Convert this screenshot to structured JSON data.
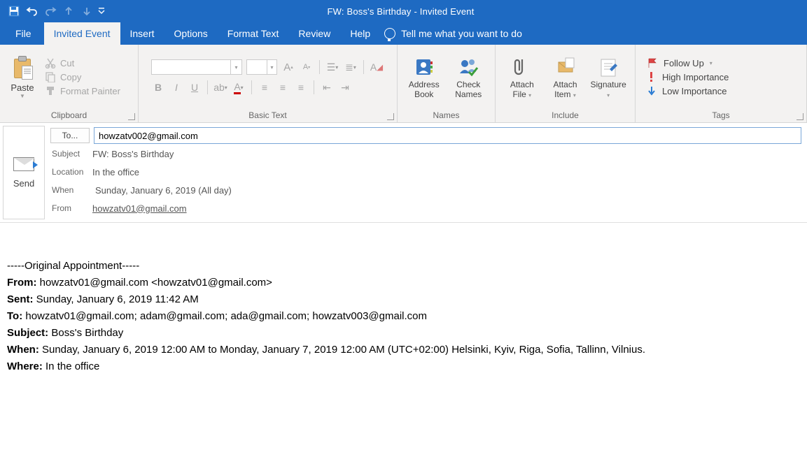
{
  "window": {
    "title": "FW: Boss's Birthday  -  Invited Event"
  },
  "tabs": {
    "file": "File",
    "invited": "Invited Event",
    "insert": "Insert",
    "options": "Options",
    "format": "Format Text",
    "review": "Review",
    "help": "Help",
    "tellme": "Tell me what you want to do"
  },
  "ribbon": {
    "clipboard": {
      "paste": "Paste",
      "cut": "Cut",
      "copy": "Copy",
      "painter": "Format Painter",
      "group": "Clipboard"
    },
    "basictext": {
      "group": "Basic Text"
    },
    "names": {
      "address1": "Address",
      "address2": "Book",
      "check1": "Check",
      "check2": "Names",
      "group": "Names"
    },
    "include": {
      "attachfile1": "Attach",
      "attachfile2": "File",
      "attachitem1": "Attach",
      "attachitem2": "Item",
      "signature": "Signature",
      "group": "Include"
    },
    "tags": {
      "followup": "Follow Up",
      "high": "High Importance",
      "low": "Low Importance",
      "group": "Tags"
    }
  },
  "compose": {
    "send": "Send",
    "to_button": "To...",
    "to_value": "howzatv002@gmail.com",
    "subject_label": "Subject",
    "subject_value": "FW: Boss's Birthday",
    "location_label": "Location",
    "location_value": "In the office",
    "when_label": "When",
    "when_value": "Sunday, January 6, 2019 (All day)",
    "from_label": "From",
    "from_value": "howzatv01@gmail.com"
  },
  "body": {
    "divider": "-----Original Appointment-----",
    "from_l": "From:",
    "from_v": " howzatv01@gmail.com <howzatv01@gmail.com>",
    "sent_l": "Sent:",
    "sent_v": " Sunday, January 6, 2019 11:42 AM",
    "to_l": "To:",
    "to_v": " howzatv01@gmail.com; adam@gmail.com; ada@gmail.com; howzatv003@gmail.com",
    "subject_l": "Subject:",
    "subject_v": " Boss's Birthday",
    "when_l": "When:",
    "when_v": " Sunday, January 6, 2019 12:00 AM to Monday, January 7, 2019 12:00 AM (UTC+02:00) Helsinki, Kyiv, Riga, Sofia, Tallinn, Vilnius.",
    "where_l": "Where:",
    "where_v": " In the office"
  }
}
